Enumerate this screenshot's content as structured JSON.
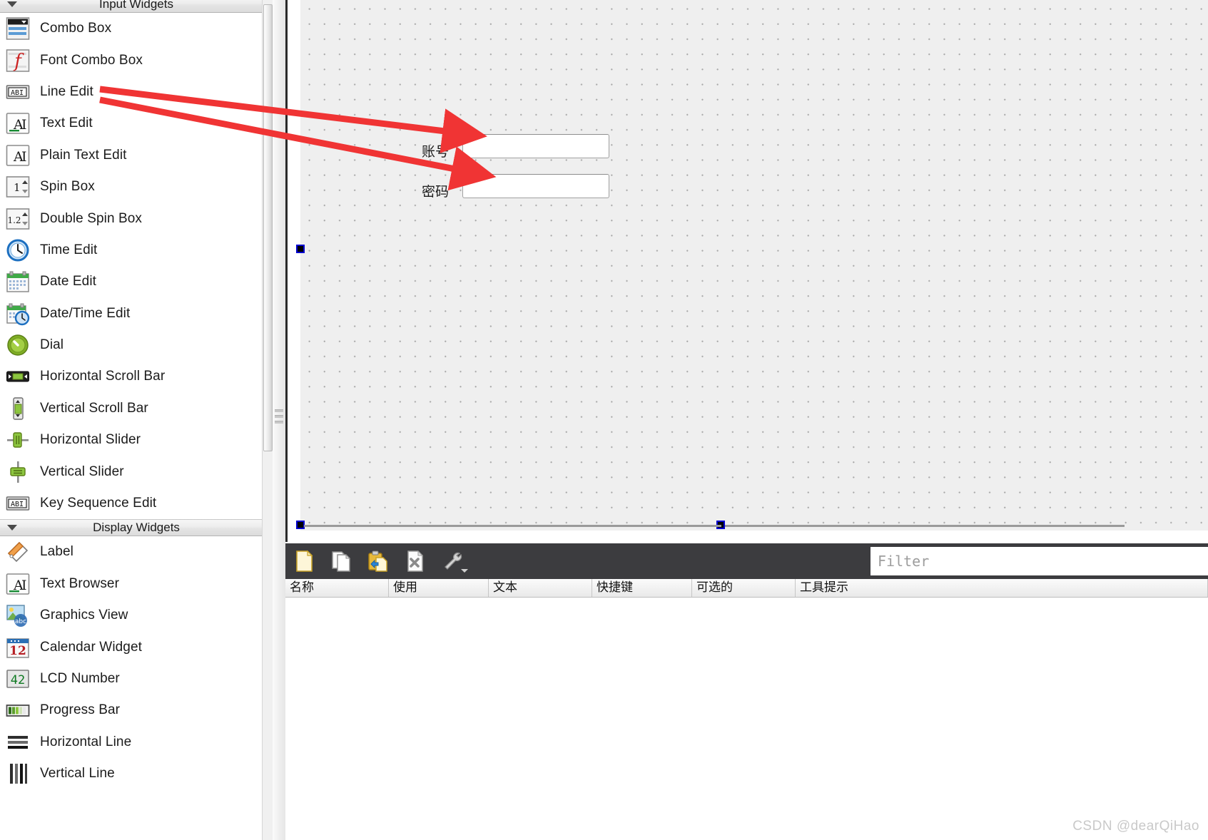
{
  "widget_box": {
    "categories": [
      {
        "title": "Input Widgets",
        "expanded": true
      },
      {
        "title": "Display Widgets",
        "expanded": true
      }
    ],
    "input_widgets": [
      {
        "label": "Combo Box",
        "icon": "combo-box-icon"
      },
      {
        "label": "Font Combo Box",
        "icon": "font-combo-box-icon"
      },
      {
        "label": "Line Edit",
        "icon": "line-edit-icon"
      },
      {
        "label": "Text Edit",
        "icon": "text-edit-icon"
      },
      {
        "label": "Plain Text Edit",
        "icon": "plain-text-edit-icon"
      },
      {
        "label": "Spin Box",
        "icon": "spin-box-icon"
      },
      {
        "label": "Double Spin Box",
        "icon": "double-spin-box-icon"
      },
      {
        "label": "Time Edit",
        "icon": "time-edit-icon"
      },
      {
        "label": "Date Edit",
        "icon": "date-edit-icon"
      },
      {
        "label": "Date/Time Edit",
        "icon": "date-time-edit-icon"
      },
      {
        "label": "Dial",
        "icon": "dial-icon"
      },
      {
        "label": "Horizontal Scroll Bar",
        "icon": "horizontal-scroll-bar-icon"
      },
      {
        "label": "Vertical Scroll Bar",
        "icon": "vertical-scroll-bar-icon"
      },
      {
        "label": "Horizontal Slider",
        "icon": "horizontal-slider-icon"
      },
      {
        "label": "Vertical Slider",
        "icon": "vertical-slider-icon"
      },
      {
        "label": "Key Sequence Edit",
        "icon": "key-sequence-edit-icon"
      }
    ],
    "display_widgets": [
      {
        "label": "Label",
        "icon": "label-icon"
      },
      {
        "label": "Text Browser",
        "icon": "text-browser-icon"
      },
      {
        "label": "Graphics View",
        "icon": "graphics-view-icon"
      },
      {
        "label": "Calendar Widget",
        "icon": "calendar-widget-icon"
      },
      {
        "label": "LCD Number",
        "icon": "lcd-number-icon"
      },
      {
        "label": "Progress Bar",
        "icon": "progress-bar-icon"
      },
      {
        "label": "Horizontal Line",
        "icon": "horizontal-line-icon"
      },
      {
        "label": "Vertical Line",
        "icon": "vertical-line-icon"
      }
    ]
  },
  "form": {
    "fields": [
      {
        "label": "账号",
        "value": "",
        "name": "account-line-edit"
      },
      {
        "label": "密码",
        "value": "",
        "name": "password-line-edit"
      }
    ]
  },
  "action_editor": {
    "toolbar": [
      {
        "name": "new-action-icon",
        "tooltip": "New"
      },
      {
        "name": "copy-action-icon",
        "tooltip": "Copy"
      },
      {
        "name": "paste-action-icon",
        "tooltip": "Paste"
      },
      {
        "name": "delete-action-icon",
        "tooltip": "Delete"
      },
      {
        "name": "configure-icon",
        "tooltip": "Configure"
      }
    ],
    "filter": {
      "placeholder": "Filter",
      "value": ""
    },
    "columns": [
      "名称",
      "使用",
      "文本",
      "快捷键",
      "可选的",
      "工具提示"
    ],
    "rows": []
  },
  "watermark": "CSDN @dearQiHao",
  "colors": {
    "canvas": "#efefef",
    "grid_dot": "#a8a8a8",
    "toolbar_dark": "#3c3c3f",
    "selection_handle": "#0000d0",
    "annotation_arrow": "#f03434"
  }
}
